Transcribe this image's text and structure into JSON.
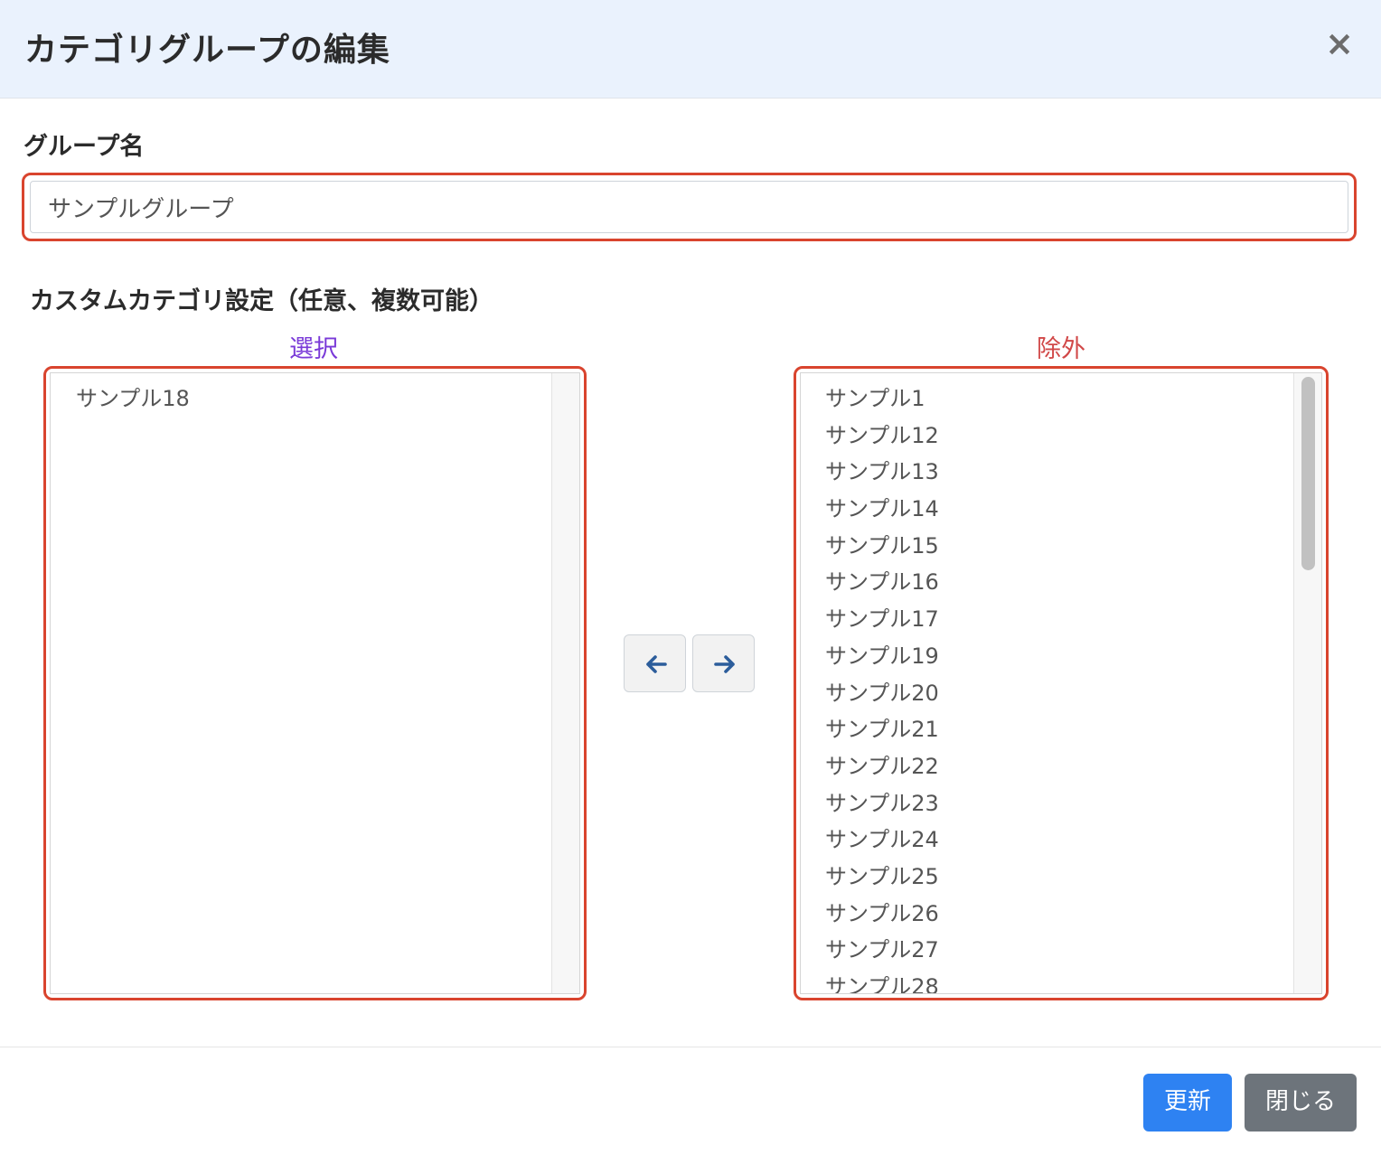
{
  "header": {
    "title": "カテゴリグループの編集",
    "close_label": "×"
  },
  "group_name": {
    "label": "グループ名",
    "value": "サンプルグループ"
  },
  "custom_category": {
    "label": "カスタムカテゴリ設定（任意、複数可能）",
    "selected_heading": "選択",
    "excluded_heading": "除外",
    "selected_items": [
      "サンプル18"
    ],
    "excluded_items": [
      "サンプル1",
      "サンプル12",
      "サンプル13",
      "サンプル14",
      "サンプル15",
      "サンプル16",
      "サンプル17",
      "サンプル19",
      "サンプル20",
      "サンプル21",
      "サンプル22",
      "サンプル23",
      "サンプル24",
      "サンプル25",
      "サンプル26",
      "サンプル27",
      "サンプル28"
    ],
    "move_left_icon": "arrow-left-icon",
    "move_right_icon": "arrow-right-icon"
  },
  "footer": {
    "update_label": "更新",
    "close_label": "閉じる"
  },
  "colors": {
    "header_bg": "#eaf2fd",
    "highlight_border": "#d9442e",
    "selected_heading": "#7a3ad8",
    "excluded_heading": "#d14848",
    "primary_button": "#2e82f2",
    "secondary_button": "#6d747b"
  }
}
